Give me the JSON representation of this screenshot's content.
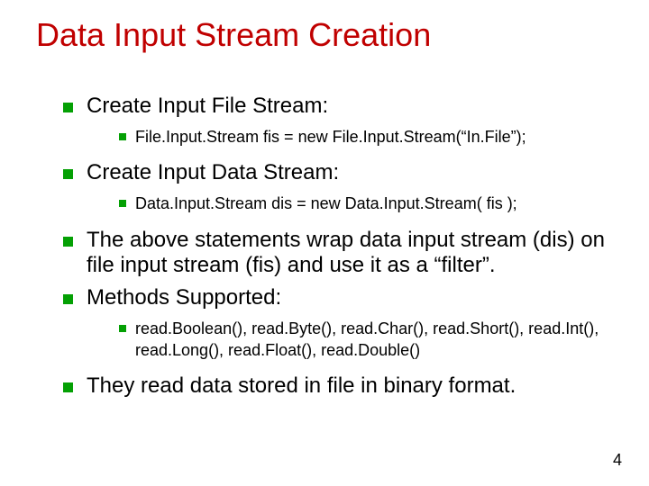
{
  "title": "Data Input Stream Creation",
  "bullets": [
    {
      "text": "Create Input File Stream:",
      "sub": [
        "File.Input.Stream fis = new File.Input.Stream(“In.File”);"
      ]
    },
    {
      "text": "Create Input Data Stream:",
      "sub": [
        "Data.Input.Stream dis = new Data.Input.Stream( fis );"
      ]
    },
    {
      "text": "The above statements wrap data input stream (dis) on file input stream (fis) and use it as a “filter”.",
      "sub": []
    },
    {
      "text": "Methods Supported:",
      "sub": [
        "read.Boolean(), read.Byte(), read.Char(), read.Short(), read.Int(), read.Long(), read.Float(), read.Double()"
      ]
    },
    {
      "text": "They read data stored in file in binary format.",
      "sub": []
    }
  ],
  "page_number": "4"
}
